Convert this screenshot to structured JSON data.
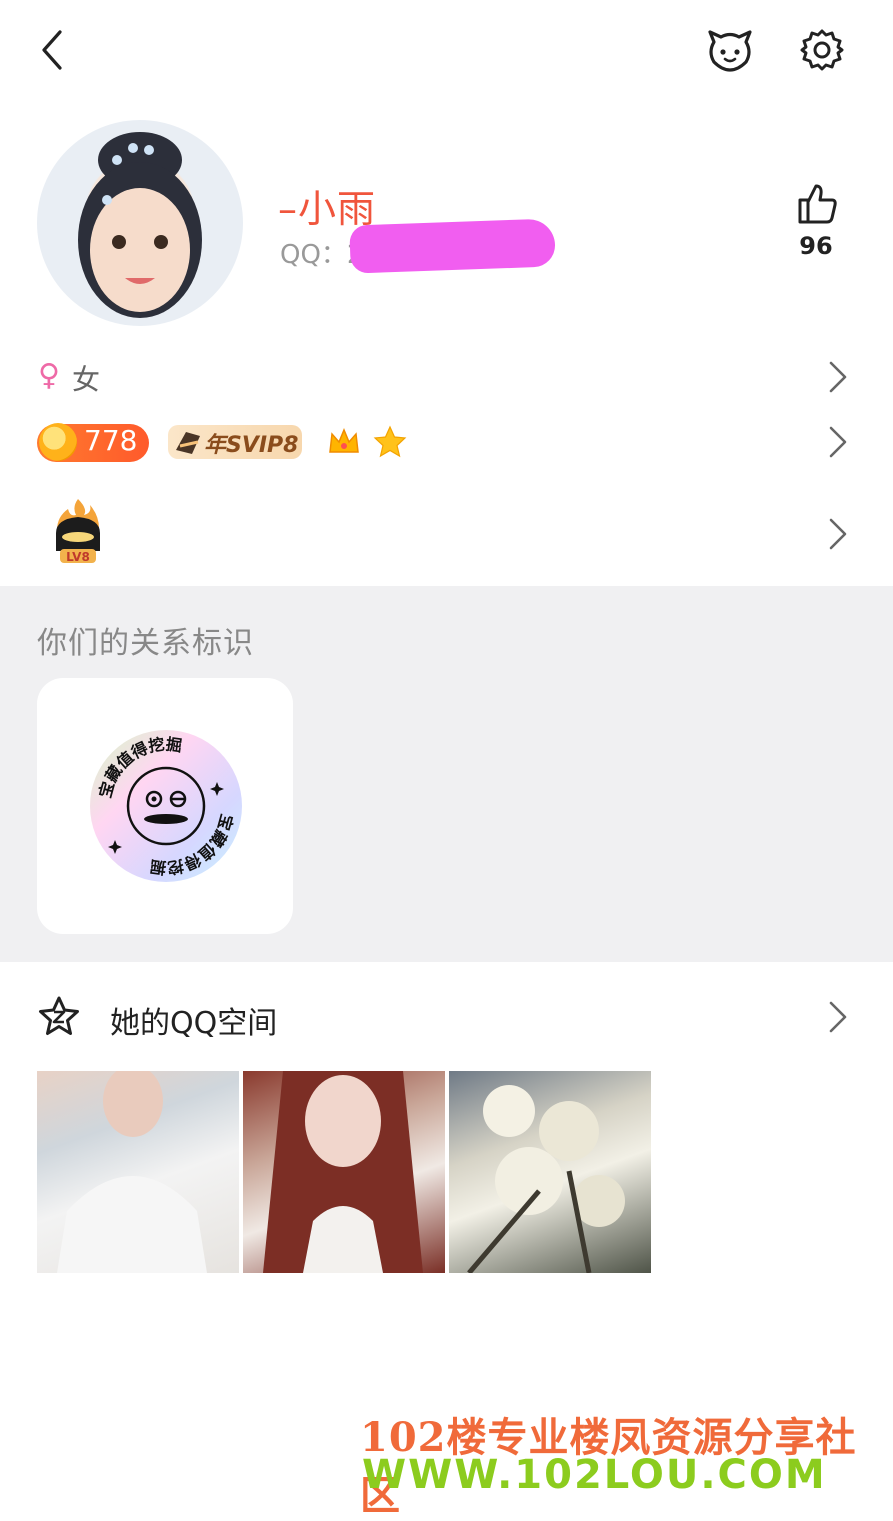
{
  "header": {
    "back_icon": "chevron-left-icon",
    "pet_icon": "pet-face-icon",
    "settings_icon": "gear-icon"
  },
  "profile": {
    "name": "–小雨",
    "qq_label": "QQ：27",
    "likes": "96",
    "like_icon": "thumbs-up-icon"
  },
  "gender": {
    "symbol": "♀",
    "label": "女"
  },
  "badges": {
    "coin_value": "778",
    "svip_label": "年SVIP8",
    "level_label": "LV8"
  },
  "relation": {
    "title": "你们的关系标识",
    "stamp_text": "宝藏值得挖掘"
  },
  "qzone": {
    "title": "她的QQ空间",
    "photos": [
      "photo-1",
      "photo-2",
      "photo-3"
    ]
  },
  "watermark": {
    "line1": "102楼专业楼凤资源分享社区",
    "line2": "WWW.102LOU.COM"
  },
  "colors": {
    "name": "#f0553c",
    "redaction": "#f15ef0",
    "section_bg": "#f0f0f2"
  }
}
